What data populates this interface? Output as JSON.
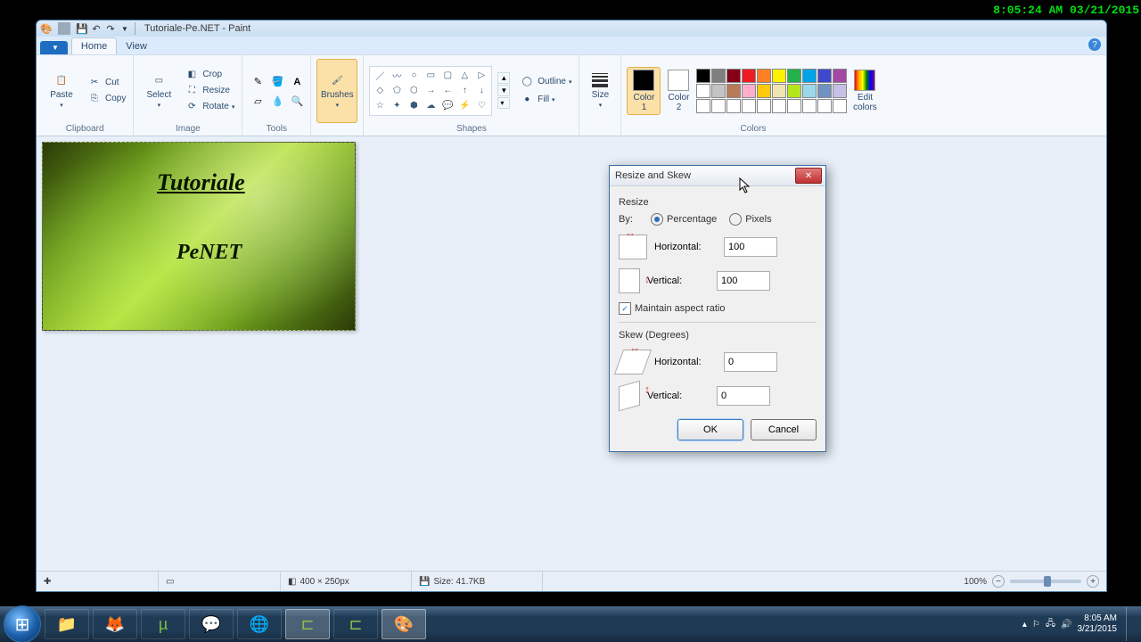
{
  "overlay_timestamp": "8:05:24 AM 03/21/2015",
  "titlebar": {
    "title": "Tutoriale-Pe.NET - Paint"
  },
  "tabs": {
    "file": "",
    "home": "Home",
    "view": "View"
  },
  "ribbon": {
    "clipboard": {
      "label": "Clipboard",
      "paste": "Paste",
      "cut": "Cut",
      "copy": "Copy"
    },
    "image": {
      "label": "Image",
      "select": "Select",
      "crop": "Crop",
      "resize": "Resize",
      "rotate": "Rotate"
    },
    "tools": {
      "label": "Tools"
    },
    "brushes": {
      "label": "Brushes"
    },
    "shapes": {
      "label": "Shapes",
      "outline": "Outline",
      "fill": "Fill"
    },
    "size": {
      "label": "Size"
    },
    "colors": {
      "label": "Colors",
      "color1": "Color\n1",
      "color2": "Color\n2",
      "edit": "Edit\ncolors"
    }
  },
  "palette_colors": [
    "#000",
    "#7f7f7f",
    "#880015",
    "#ed1c24",
    "#ff7f27",
    "#fff200",
    "#22b14c",
    "#00a2e8",
    "#3f48cc",
    "#a349a4",
    "#fff",
    "#c3c3c3",
    "#b97a57",
    "#ffaec9",
    "#ffc90e",
    "#efe4b0",
    "#b5e61d",
    "#99d9ea",
    "#7092be",
    "#c8bfe7",
    "#fff",
    "#fff",
    "#fff",
    "#fff",
    "#fff",
    "#fff",
    "#fff",
    "#fff",
    "#fff",
    "#fff"
  ],
  "canvas": {
    "text1": "Tutoriale",
    "text2": "PeNET"
  },
  "dialog": {
    "title": "Resize and Skew",
    "resize": "Resize",
    "by": "By:",
    "percentage": "Percentage",
    "pixels": "Pixels",
    "horizontal": "Horizontal:",
    "vertical": "Vertical:",
    "h_val": "100",
    "v_val": "100",
    "maintain": "Maintain aspect ratio",
    "skew": "Skew (Degrees)",
    "sh_val": "0",
    "sv_val": "0",
    "ok": "OK",
    "cancel": "Cancel"
  },
  "status": {
    "dims": "400 × 250px",
    "size": "Size: 41.7KB",
    "zoom": "100%"
  },
  "tray": {
    "time": "8:05 AM",
    "date": "3/21/2015"
  }
}
